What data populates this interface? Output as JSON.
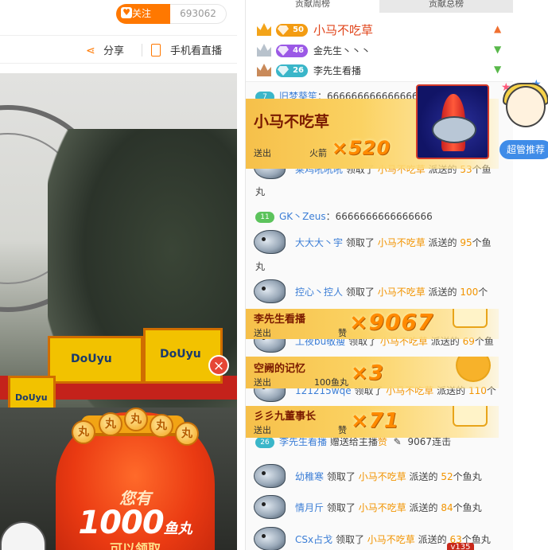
{
  "header": {
    "follow_label": "关注",
    "follow_count": "693062",
    "share_label": "分享",
    "phone_watch_label": "手机看直播"
  },
  "video": {
    "signs": [
      "DoUyu",
      "DoUyu",
      "DoUyu"
    ],
    "close_symbol": "×",
    "promo_line1": "您有",
    "promo_amount": "1000",
    "promo_unit": "鱼丸",
    "promo_line3": "可以领取"
  },
  "leaderboard": {
    "tabs": [
      {
        "label": "贡献周榜",
        "active": true
      },
      {
        "label": "贡献总榜",
        "active": false
      }
    ],
    "rows": [
      {
        "rank": 1,
        "level": "50",
        "badge_color": "#f39c12",
        "name": "小马不吃草",
        "trend": "up",
        "trend_symbol": "▲",
        "trend_color": "#f07030",
        "highlight": true
      },
      {
        "rank": 2,
        "level": "46",
        "badge_color": "#9b59e6",
        "name": "金先生丶丶丶",
        "trend": "down",
        "trend_symbol": "▼",
        "trend_color": "#59b84a",
        "highlight": false
      },
      {
        "rank": 3,
        "level": "26",
        "badge_color": "#3ab6c9",
        "name": "李先生看播",
        "trend": "down",
        "trend_symbol": "▼",
        "trend_color": "#59b84a",
        "highlight": false
      }
    ]
  },
  "feed": {
    "rows": [
      {
        "type": "chat",
        "badge": "7",
        "user": "旧梦葵笙",
        "text": "：6666666666666666"
      },
      {
        "type": "claim",
        "user": "莱鸡吼吼吼",
        "verb": "领取了",
        "sender": "小马不吃草",
        "mid": "派送的",
        "count": "53",
        "unit": "个鱼",
        "wrap": "丸"
      },
      {
        "type": "chat",
        "badge": "11",
        "user": "GK丶Zeus",
        "text": "：6666666666666666"
      },
      {
        "type": "claim",
        "user": "大大大丶宇",
        "verb": "领取了",
        "sender": "小马不吃草",
        "mid": "派送的",
        "count": "95",
        "unit": "个鱼",
        "wrap": "丸"
      },
      {
        "type": "claim",
        "user": "控心丶控人",
        "verb": "领取了",
        "sender": "小马不吃草",
        "mid": "派送的",
        "count": "100",
        "unit": "个",
        "wrap": ""
      },
      {
        "type": "claim",
        "user": "工夜bu敬瘦",
        "verb": "领取了",
        "sender": "小马不吃草",
        "mid": "派送的",
        "count": "69",
        "unit": "个鱼",
        "wrap": ""
      },
      {
        "type": "claim",
        "user": "121215wqe",
        "verb": "领取了",
        "sender": "小马不吃草",
        "mid": "派送的",
        "count": "110",
        "unit": "个",
        "wrap": ""
      },
      {
        "type": "gift",
        "badge": "26",
        "user": "李先生看播",
        "verb": "赠送给主播",
        "gift": "赞",
        "combo": "9067连击"
      },
      {
        "type": "claim",
        "user": "幼稚寒",
        "verb": "领取了",
        "sender": "小马不吃草",
        "mid": "派送的",
        "count": "52",
        "unit": "个鱼丸",
        "wrap": ""
      },
      {
        "type": "claim",
        "user": "情月斤",
        "verb": "领取了",
        "sender": "小马不吃草",
        "mid": "派送的",
        "count": "84",
        "unit": "个鱼丸",
        "wrap": ""
      },
      {
        "type": "claim",
        "user": "CSx占戈",
        "verb": "领取了",
        "sender": "小马不吃草",
        "mid": "派送的",
        "count": "63",
        "unit": "个鱼丸",
        "wrap": ""
      }
    ],
    "level_tag": "v135"
  },
  "gift_popups": [
    {
      "name": "小马不吃草",
      "to": "送出",
      "gift": "火箭",
      "count": "×520",
      "icon": "rocket-icon"
    },
    {
      "name": "李先生看播",
      "to": "送出",
      "gift": "赞",
      "count": "×9067",
      "icon": "thumbs-up-icon"
    },
    {
      "name": "空阙的记忆",
      "to": "送出",
      "gift": "100鱼丸",
      "count": "×3",
      "icon": "fishball-icon"
    },
    {
      "name": "彡彡九董事长",
      "to": "送出",
      "gift": "赞",
      "count": "×71",
      "icon": "thumbs-up-icon"
    }
  ],
  "promo_side": {
    "label": "超管推荐"
  }
}
